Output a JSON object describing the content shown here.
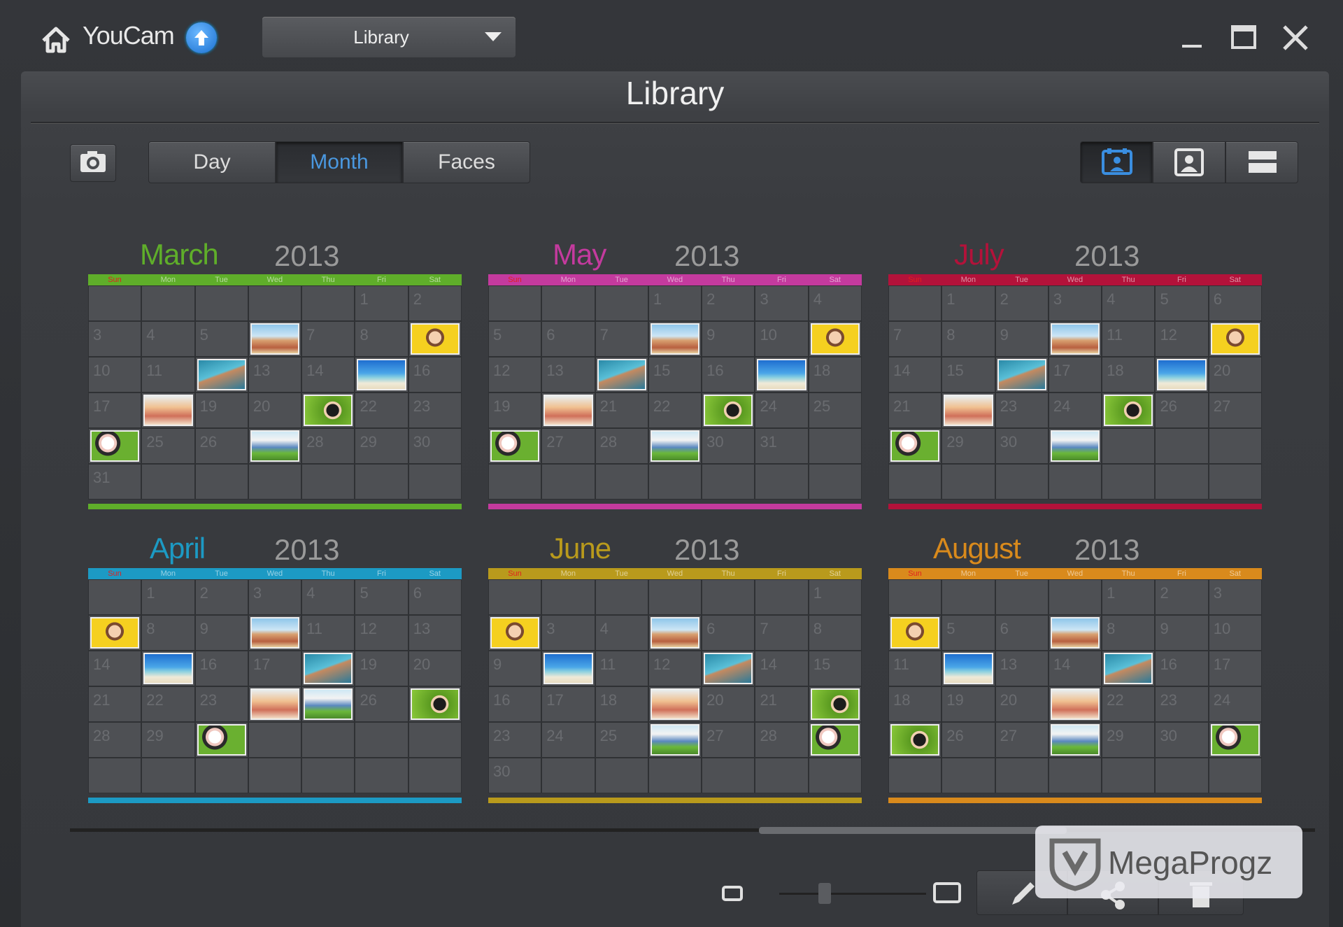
{
  "app": {
    "brand": "YouCam",
    "view_dropdown": "Library"
  },
  "panel": {
    "title": "Library"
  },
  "tabs": [
    "Day",
    "Month",
    "Faces"
  ],
  "active_tab": "Month",
  "weekdays": [
    "Sun",
    "Mon",
    "Tue",
    "Wed",
    "Thu",
    "Fri",
    "Sat"
  ],
  "months": [
    {
      "name": "March",
      "year": "2013",
      "color": "#5fae2a",
      "start": 5,
      "days": 31,
      "photos": [
        {
          "day": 6,
          "kind": "group"
        },
        {
          "day": 9,
          "kind": "yellow"
        },
        {
          "day": 12,
          "kind": "kite"
        },
        {
          "day": 15,
          "kind": "beach"
        },
        {
          "day": 18,
          "kind": "kids"
        },
        {
          "day": 21,
          "kind": "dog"
        },
        {
          "day": 24,
          "kind": "baby"
        },
        {
          "day": 27,
          "kind": "boy"
        }
      ]
    },
    {
      "name": "May",
      "year": "2013",
      "color": "#c43a9e",
      "start": 3,
      "days": 31,
      "photos": [
        {
          "day": 8,
          "kind": "group"
        },
        {
          "day": 11,
          "kind": "yellow"
        },
        {
          "day": 14,
          "kind": "kite"
        },
        {
          "day": 17,
          "kind": "beach"
        },
        {
          "day": 20,
          "kind": "kids"
        },
        {
          "day": 23,
          "kind": "dog"
        },
        {
          "day": 26,
          "kind": "baby"
        },
        {
          "day": 29,
          "kind": "boy"
        }
      ]
    },
    {
      "name": "July",
      "year": "2013",
      "color": "#b3123a",
      "start": 1,
      "days": 31,
      "photos": [
        {
          "day": 10,
          "kind": "group"
        },
        {
          "day": 13,
          "kind": "yellow"
        },
        {
          "day": 16,
          "kind": "kite"
        },
        {
          "day": 19,
          "kind": "beach"
        },
        {
          "day": 22,
          "kind": "kids"
        },
        {
          "day": 25,
          "kind": "dog"
        },
        {
          "day": 28,
          "kind": "baby"
        },
        {
          "day": 31,
          "kind": "boy"
        }
      ]
    },
    {
      "name": "April",
      "year": "2013",
      "color": "#1c9ac4",
      "start": 1,
      "days": 30,
      "photos": [
        {
          "day": 7,
          "kind": "yellow"
        },
        {
          "day": 10,
          "kind": "group"
        },
        {
          "day": 15,
          "kind": "beach"
        },
        {
          "day": 18,
          "kind": "kite"
        },
        {
          "day": 24,
          "kind": "kids"
        },
        {
          "day": 25,
          "kind": "boy"
        },
        {
          "day": 27,
          "kind": "dog"
        },
        {
          "day": 30,
          "kind": "baby"
        }
      ]
    },
    {
      "name": "June",
      "year": "2013",
      "color": "#b99a1c",
      "start": 6,
      "days": 30,
      "photos": [
        {
          "day": 2,
          "kind": "yellow"
        },
        {
          "day": 5,
          "kind": "group"
        },
        {
          "day": 10,
          "kind": "beach"
        },
        {
          "day": 13,
          "kind": "kite"
        },
        {
          "day": 19,
          "kind": "kids"
        },
        {
          "day": 26,
          "kind": "boy"
        },
        {
          "day": 29,
          "kind": "baby"
        },
        {
          "day": 22,
          "kind": "dog"
        }
      ]
    },
    {
      "name": "August",
      "year": "2013",
      "color": "#d98a1c",
      "start": 4,
      "days": 31,
      "photos": [
        {
          "day": 4,
          "kind": "yellow"
        },
        {
          "day": 7,
          "kind": "group"
        },
        {
          "day": 12,
          "kind": "beach"
        },
        {
          "day": 15,
          "kind": "kite"
        },
        {
          "day": 21,
          "kind": "kids"
        },
        {
          "day": 28,
          "kind": "boy"
        },
        {
          "day": 31,
          "kind": "baby"
        },
        {
          "day": 25,
          "kind": "dog"
        }
      ]
    }
  ],
  "watermark": "MegaProgz"
}
